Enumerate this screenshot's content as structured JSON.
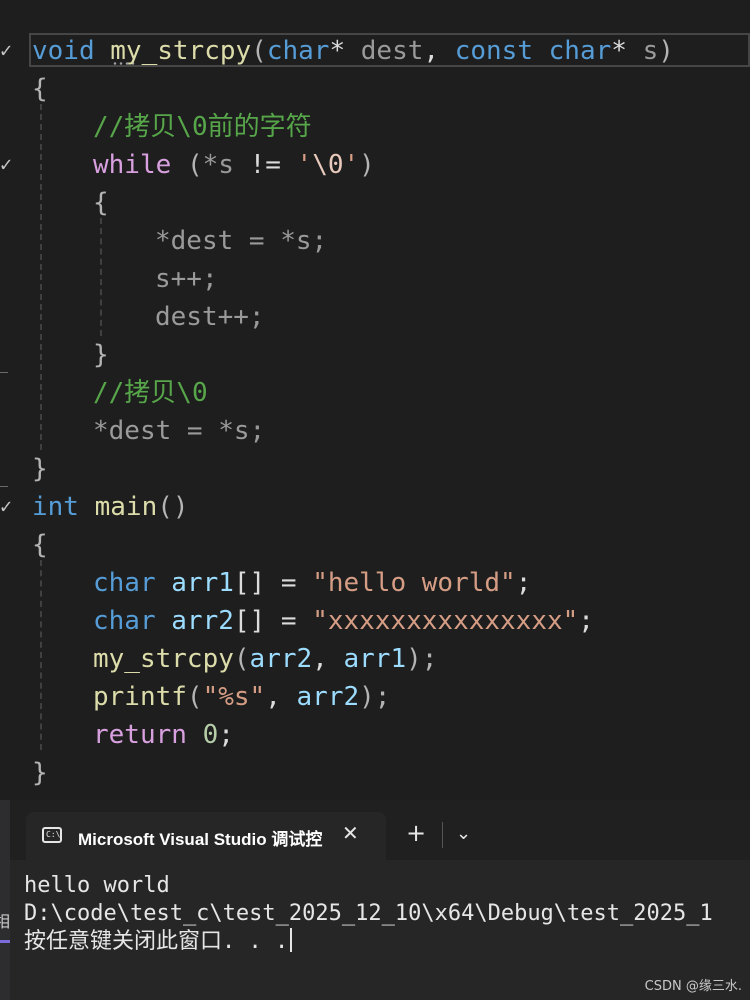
{
  "editor": {
    "code": {
      "l1_kw": "void",
      "l1_fn": "my_strcpy",
      "l1_p1": "(",
      "l1_type1": "char",
      "l1_star1": "*",
      "l1_arg1": "dest",
      "l1_comma": ",",
      "l1_const": "const",
      "l1_type2": "char",
      "l1_star2": "*",
      "l1_arg2": "s",
      "l1_p2": ")",
      "l2": "{",
      "l3_comment": "//拷贝\\0前的字符",
      "l4_while": "while",
      "l4_p1": "(",
      "l4_expr": "*s",
      "l4_op": "!=",
      "l4_q1": "'",
      "l4_esc": "\\0",
      "l4_q2": "'",
      "l4_p2": ")",
      "l5": "{",
      "l6": "*dest = *s;",
      "l7": "s++;",
      "l8": "dest++;",
      "l9": "}",
      "l10_comment": "//拷贝\\0",
      "l11": "*dest = *s;",
      "l12": "}",
      "l13_kw": "int",
      "l13_fn": "main",
      "l13_rest": "()",
      "l14": "{",
      "l15_kw": "char",
      "l15_var": "arr1",
      "l15_mid": "[] =",
      "l15_str": "\"hello world\"",
      "l15_end": ";",
      "l16_kw": "char",
      "l16_var": "arr2",
      "l16_mid": "[] =",
      "l16_str": "\"xxxxxxxxxxxxxxx\"",
      "l16_end": ";",
      "l17_fn": "my_strcpy",
      "l17_p1": "(",
      "l17_a": "arr2",
      "l17_c": ",",
      "l17_b": "arr1",
      "l17_end": ");",
      "l18_fn": "printf",
      "l18_p1": "(",
      "l18_str": "\"%s\"",
      "l18_c": ",",
      "l18_var": "arr2",
      "l18_end": ");",
      "l19_kw": "return",
      "l19_num": "0",
      "l19_end": ";",
      "l20": "}"
    },
    "colors": {
      "keyword": "#569cd6",
      "control": "#d8a0df",
      "function": "#dcdcaa",
      "variable": "#9cdcfe",
      "string": "#d69d85",
      "comment": "#57a64a",
      "number": "#b5cea8"
    }
  },
  "terminal": {
    "tab_icon": "console-icon",
    "tab_icon_text": "C:\\",
    "tab_title": "Microsoft Visual Studio 调试控",
    "close_icon": "✕",
    "new_tab_icon": "+",
    "dropdown_icon": "⌄",
    "lines": [
      "hello world",
      "D:\\code\\test_c\\test_2025_12_10\\x64\\Debug\\test_2025_1",
      "按任意键关闭此窗口. . ."
    ],
    "left_fragment": "相"
  },
  "watermark": "CSDN @缘三水."
}
